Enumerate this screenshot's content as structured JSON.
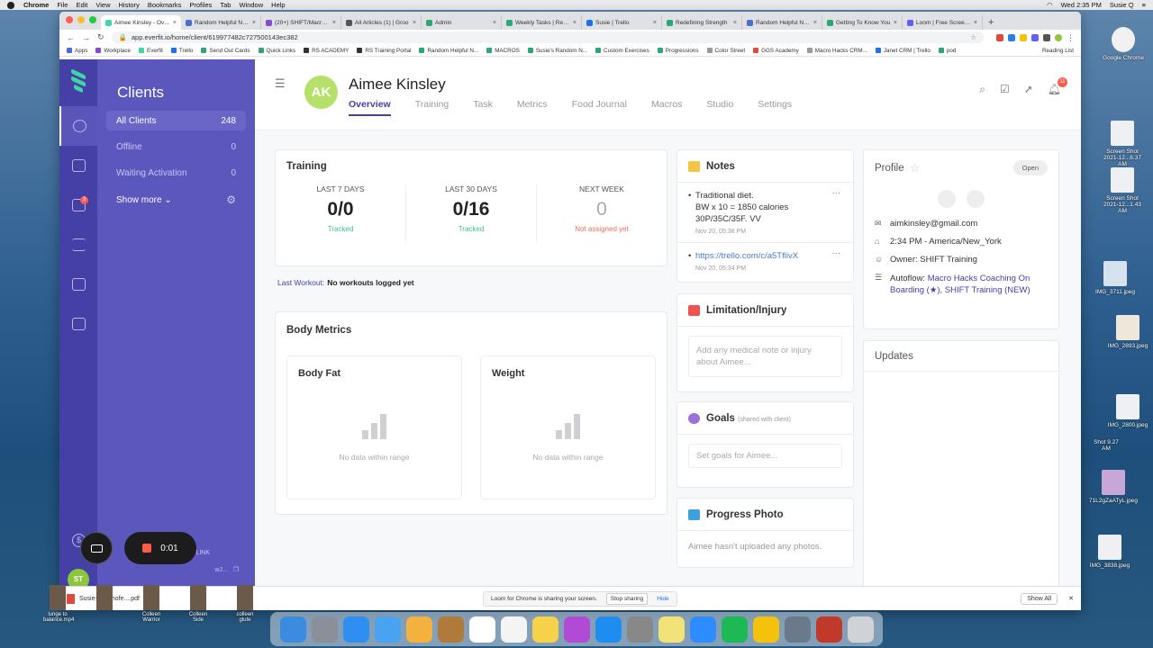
{
  "menubar": {
    "app": "Chrome",
    "items": [
      "File",
      "Edit",
      "View",
      "History",
      "Bookmarks",
      "Profiles",
      "Tab",
      "Window",
      "Help"
    ],
    "clock": "Wed 2:35 PM",
    "user": "Susie Q"
  },
  "tabs": [
    {
      "title": "Aimee Kinsley - Overv",
      "color": "#3fd6a6"
    },
    {
      "title": "Random Helpful Notes",
      "color": "#4a6fd0"
    },
    {
      "title": "(20+) SHIFT/Macro H",
      "color": "#8a4ad0"
    },
    {
      "title": "All Articles (1) | Groo",
      "color": "#555555"
    },
    {
      "title": "Admin",
      "color": "#2aa876"
    },
    {
      "title": "Weekly Tasks | Redef",
      "color": "#2aa876"
    },
    {
      "title": "Susie | Trello",
      "color": "#1a73e8"
    },
    {
      "title": "Redefining Strength",
      "color": "#2aa876"
    },
    {
      "title": "Random Helpful Notes",
      "color": "#4a6fd0"
    },
    {
      "title": "Getting To Know You",
      "color": "#2aa876"
    },
    {
      "title": "Loom | Free Screen &",
      "color": "#625df5"
    }
  ],
  "url": "app.everfit.io/home/client/619977482c727500143ec382",
  "bookmarks": [
    "Apps",
    "Workplace",
    "Everfit",
    "Trello",
    "Send Out Cards",
    "Quick Links",
    "RS ACADEMY",
    "RS Training Portal",
    "Random Helpful N...",
    "MACROS",
    "Susie's Random N...",
    "Custom Exercises",
    "Progressions",
    "Color Street",
    "GGS Academy",
    "Macro Hacks CRM...",
    "Janet CRM | Trello",
    "pod"
  ],
  "reading_list": "Reading List",
  "sidebar": {
    "title": "Clients",
    "items": [
      {
        "label": "All Clients",
        "count": "248"
      },
      {
        "label": "Offline",
        "count": "0"
      },
      {
        "label": "Waiting Activation",
        "count": "0"
      }
    ],
    "show_more": "Show more",
    "invite_label": "LINK",
    "invite_code": "wJ...",
    "badge": "3",
    "avatar": "ST"
  },
  "client": {
    "initials": "AK",
    "name": "Aimee Kinsley",
    "tabs": [
      "Overview",
      "Training",
      "Task",
      "Metrics",
      "Food Journal",
      "Macros",
      "Studio",
      "Settings"
    ],
    "notifications": "11"
  },
  "training": {
    "title": "Training",
    "stats": [
      {
        "label": "LAST 7 DAYS",
        "value": "0/0",
        "sub": "Tracked"
      },
      {
        "label": "LAST 30 DAYS",
        "value": "0/16",
        "sub": "Tracked"
      },
      {
        "label": "NEXT WEEK",
        "value": "0",
        "sub": "Not assigned yet"
      }
    ],
    "last_workout_label": "Last Workout:",
    "last_workout_value": "No workouts logged yet"
  },
  "body_metrics": {
    "title": "Body Metrics",
    "cards": [
      {
        "title": "Body Fat",
        "empty": "No data within range"
      },
      {
        "title": "Weight",
        "empty": "No data within range"
      }
    ]
  },
  "notes": {
    "title": "Notes",
    "items": [
      {
        "line1": "Traditional diet.",
        "line2": "BW x 10 = 1850 calories",
        "line3": "30P/35C/35F. VV",
        "date": "Nov 20, 05:38 PM"
      },
      {
        "link": "https://trello.com/c/a5TflivX",
        "date": "Nov 20, 05:34 PM"
      }
    ]
  },
  "limitation": {
    "title": "Limitation/Injury",
    "placeholder": "Add any medical note or injury about Aimee..."
  },
  "goals": {
    "title": "Goals",
    "shared": "(shared with client)",
    "placeholder": "Set goals for Aimee..."
  },
  "progress": {
    "title": "Progress Photo",
    "empty": "Aimee hasn't uploaded any photos."
  },
  "profile": {
    "title": "Profile",
    "open": "Open",
    "email": "aimkinsley@gmail.com",
    "time": "2:34 PM - America/New_York",
    "owner": "Owner: SHIFT Training",
    "autoflow_label": "Autoflow:",
    "autoflow_value": "Macro Hacks Coaching On Boarding (★), SHIFT Training (NEW)"
  },
  "updates": {
    "title": "Updates"
  },
  "downloads": {
    "file": "Susie-Richthofe....pdf",
    "share_text": "Loom for Chrome is sharing your screen.",
    "stop": "Stop sharing",
    "hide": "Hide",
    "show_all": "Show All"
  },
  "loom": {
    "timer": "0:01"
  },
  "desktop": [
    {
      "label": "Google Chrome"
    },
    {
      "label": "Screen Shot 2021-12...6.37 AM"
    },
    {
      "label": "Screen Shot 2021-12...1.43 AM"
    },
    {
      "label": "IMG_3711.jpeg"
    },
    {
      "label": "IMG_2893.jpeg"
    },
    {
      "label": "IMG_2800.jpeg"
    },
    {
      "label": "Shot 9.27 AM"
    },
    {
      "label": "71L2gZaATyL.jpeg"
    },
    {
      "label": "IMG_3838.jpeg"
    }
  ],
  "dock_thumbs": [
    {
      "label": "lunge to balance.mp4"
    },
    {
      "label": ""
    },
    {
      "label": "Colleen Warrior"
    },
    {
      "label": "Colleen Side"
    },
    {
      "label": "colleen glute"
    }
  ],
  "dock_colors": [
    "#3b8be0",
    "#8a8f9a",
    "#2f8ff0",
    "#4aa3f0",
    "#f3b240",
    "#b07a3a",
    "#ffffff",
    "#f4f4f4",
    "#f6d24a",
    "#b24ad6",
    "#1f8cf0",
    "#888888",
    "#f2e27a",
    "#2d8cff",
    "#1db954",
    "#f4c20d",
    "#6b7a8a",
    "#c0392b",
    "#cfd3d8"
  ]
}
